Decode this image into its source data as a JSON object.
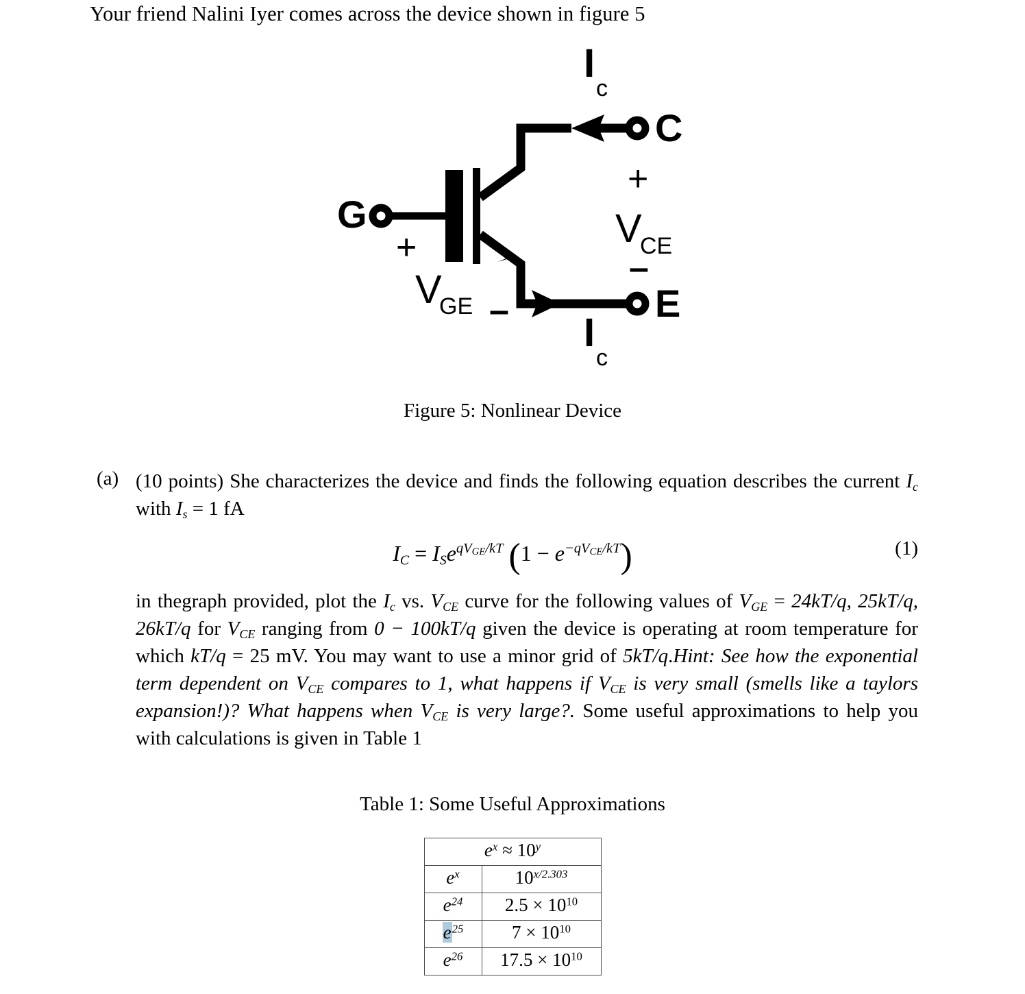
{
  "document": {
    "intro_line": "Your friend Nalini Iyer comes across the device shown in figure 5"
  },
  "figure": {
    "caption": "Figure 5: Nonlinear Device",
    "circuit": {
      "type": "igbt-symbol",
      "terminals": [
        {
          "id": "gate",
          "label": "G"
        },
        {
          "id": "collector",
          "label": "C"
        },
        {
          "id": "emitter",
          "label": "E"
        }
      ],
      "current_labels": [
        {
          "id": "ic-top",
          "symbol": "I",
          "subscript": "c"
        },
        {
          "id": "ic-bottom",
          "symbol": "I",
          "subscript": "c"
        }
      ],
      "voltage_labels": [
        {
          "id": "vge",
          "symbol": "V",
          "subscript": "GE",
          "plus": "+",
          "minus": "–"
        },
        {
          "id": "vce",
          "symbol": "V",
          "subscript": "CE",
          "plus": "+",
          "minus": "–"
        }
      ]
    }
  },
  "part_a": {
    "label": "(a)",
    "points_text": "(10 points)",
    "lead_in": " She characterizes the device and finds the following equation describes the current ",
    "current_symbol": "I",
    "current_subscript": "c",
    "with_text": " with ",
    "is_symbol": "I",
    "is_subscript": "s",
    "is_value": " = 1 fA"
  },
  "equation": {
    "number": "(1)",
    "lhs_symbol": "I",
    "lhs_subscript": "C",
    "equals": " = ",
    "is_symbol": "I",
    "is_subscript": "S",
    "e_symbol": "e",
    "exponent_1": "qV",
    "exponent_1_sub": "GE",
    "exponent_1_tail": "/kT",
    "open_paren": "(",
    "one": "1 − ",
    "e_symbol_2": "e",
    "exponent_2": "−qV",
    "exponent_2_sub": "CE",
    "exponent_2_tail": "/kT",
    "close_paren": ")",
    "plain_text": "I_C = I_S e^(qV_GE/kT) (1 - e^(-qV_CE/kT))"
  },
  "body_paragraph": {
    "s1": "in thegraph provided, plot the ",
    "ic_symbol": "I",
    "ic_sub": "c",
    "s2": " vs. ",
    "vce_symbol": "V",
    "vce_sub": "CE",
    "s3": " curve for the following values of ",
    "vge_symbol": "V",
    "vge_sub": "GE",
    "s4": " = ",
    "values_list": "24kT/q, 25kT/q, 26kT/q",
    "s5": " for ",
    "s6": " ranging from ",
    "range": "0 − 100kT/q",
    "s7": " given the device is operating at room temperature for which ",
    "ktq": "kT/q",
    "s8": " = 25 mV. You may want to use a minor grid of ",
    "minor_grid": "5kT/q",
    "s9": ".",
    "hint_label": "Hint:",
    "hint_1": " See how the exponential term dependent on ",
    "hint_2": " compares to 1, what happens if ",
    "hint_3": " is very small (smells like a taylors expansion!)? What happens when ",
    "hint_4": " is very large?.",
    "s10": " Some useful approximations to help you with calculations is given in Table 1"
  },
  "table": {
    "caption": "Table 1: Some Useful Approximations",
    "header": {
      "e": "e",
      "x": "x",
      "approx": " ≈ ",
      "ten": "10",
      "y": "y"
    },
    "rows": [
      {
        "left_base": "e",
        "left_exp": "x",
        "right_text": "10",
        "right_exp": "x/2.303",
        "selected": false
      },
      {
        "left_base": "e",
        "left_exp": "24",
        "right_text": "2.5 × 10",
        "right_exp": "10",
        "selected": false
      },
      {
        "left_base": "e",
        "left_exp": "25",
        "right_text": "7 × 10",
        "right_exp": "10",
        "selected": true
      },
      {
        "left_base": "e",
        "left_exp": "26",
        "right_text": "17.5 × 10",
        "right_exp": "10",
        "selected": false
      }
    ],
    "selection_color": "#aecbdd"
  }
}
